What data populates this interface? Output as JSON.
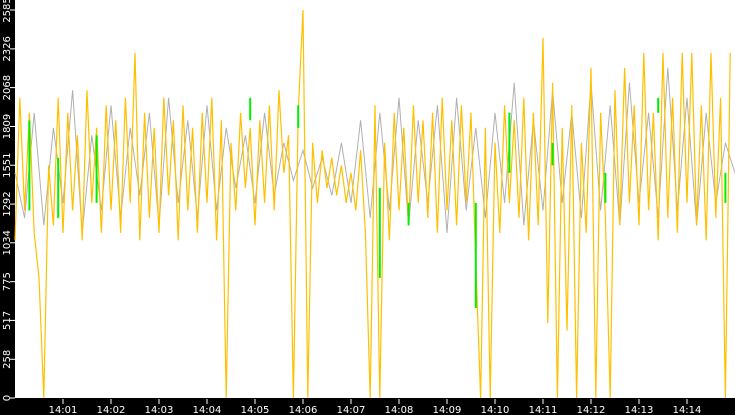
{
  "chart_data": {
    "type": "line",
    "title": "",
    "xlabel": "",
    "ylabel": "",
    "x_unit": "minutes after 14:00",
    "xlim": [
      0,
      15
    ],
    "ylim": [
      0,
      2585
    ],
    "grid": false,
    "y_ticks": [
      "0",
      "258",
      "517",
      "775",
      "1034",
      "1292",
      "1551",
      "1809",
      "2068",
      "2326",
      "2585"
    ],
    "y_tick_values": [
      0,
      258,
      517,
      775,
      1034,
      1292,
      1551,
      1809,
      2068,
      2326,
      2585
    ],
    "x_ticks": [
      "14:01",
      "14:02",
      "14:03",
      "14:04",
      "14:05",
      "14:06",
      "14:07",
      "14:08",
      "14:09",
      "14:10",
      "14:11",
      "14:12",
      "14:13",
      "14:14"
    ],
    "x_tick_values": [
      1,
      2,
      3,
      4,
      5,
      6,
      7,
      8,
      9,
      10,
      11,
      12,
      13,
      14
    ],
    "series": [
      {
        "name": "gray",
        "color": "#b0b0b0",
        "step": 0.2,
        "values": [
          1500,
          1200,
          1900,
          1150,
          1800,
          1300,
          2050,
          1100,
          1750,
          1250,
          1950,
          1200,
          1800,
          1350,
          1900,
          1150,
          2000,
          1300,
          1850,
          1200,
          1950,
          1250,
          1800,
          1400,
          1750,
          1300,
          1900,
          1350,
          1700,
          1450,
          1650,
          1400,
          1600,
          1350,
          1700,
          1300,
          1850,
          1200,
          1900,
          1250,
          2000,
          1150,
          1850,
          1300,
          1950,
          1100,
          2000,
          1250,
          1800,
          1200,
          1900,
          1300,
          2100,
          1150,
          1850,
          1250,
          2050,
          1300,
          1900,
          1200,
          2100,
          1250,
          1950,
          1150,
          2100,
          1300,
          1900,
          1200,
          2200,
          1250,
          2000,
          1150,
          1900,
          1300,
          1700,
          1500
        ]
      },
      {
        "name": "yellow",
        "color": "#ffc000",
        "step": 0.1,
        "values": [
          1050,
          2000,
          1250,
          1900,
          1100,
          800,
          0,
          1550,
          1150,
          2000,
          1100,
          1900,
          1250,
          1750,
          1050,
          2050,
          1300,
          1800,
          1100,
          1950,
          1250,
          1850,
          1100,
          2000,
          1300,
          2300,
          1050,
          1900,
          1200,
          1800,
          1100,
          2000,
          1350,
          1850,
          1050,
          1950,
          1250,
          1800,
          1100,
          1900,
          1300,
          2000,
          1050,
          1850,
          0,
          1700,
          1250,
          1900,
          1400,
          1800,
          1150,
          1850,
          1300,
          1950,
          1250,
          2050,
          1500,
          1750,
          0,
          1900,
          2585,
          0,
          1700,
          1300,
          1650,
          1400,
          1600,
          1350,
          1550,
          1300,
          1500,
          1250,
          1650,
          1100,
          0,
          1950,
          0,
          1700,
          1050,
          1900,
          1250,
          1800,
          1150,
          1950,
          1300,
          1850,
          1200,
          1900,
          1100,
          2000,
          1250,
          1850,
          1150,
          1950,
          1300,
          1900,
          900,
          0,
          1800,
          0,
          1700,
          1100,
          1950,
          1300,
          1850,
          1200,
          2000,
          1050,
          1900,
          1150,
          2400,
          500,
          2100,
          0,
          1800,
          450,
          1950,
          0,
          1700,
          1100,
          2200,
          0,
          1900,
          1200,
          0,
          2050,
          1150,
          2200,
          1300,
          1950,
          1150,
          2300,
          1250,
          1900,
          1050,
          2300,
          1200,
          2000,
          1100,
          2300,
          1300,
          2300,
          1150,
          1950,
          1050,
          2300,
          1200,
          2000,
          0,
          2300
        ]
      },
      {
        "name": "green",
        "color": "#00ee00",
        "segments": [
          [
            0.3,
            1250,
            1850
          ],
          [
            0.9,
            1200,
            1600
          ],
          [
            1.7,
            1300,
            1750
          ],
          [
            4.9,
            1850,
            2000
          ],
          [
            5.9,
            1800,
            1950
          ],
          [
            7.6,
            800,
            1400
          ],
          [
            8.2,
            1150,
            1300
          ],
          [
            9.6,
            600,
            1300
          ],
          [
            10.3,
            1500,
            1900
          ],
          [
            11.2,
            1550,
            1700
          ],
          [
            12.3,
            1300,
            1500
          ],
          [
            13.4,
            1900,
            2000
          ],
          [
            14.8,
            1300,
            1500
          ]
        ]
      }
    ]
  }
}
